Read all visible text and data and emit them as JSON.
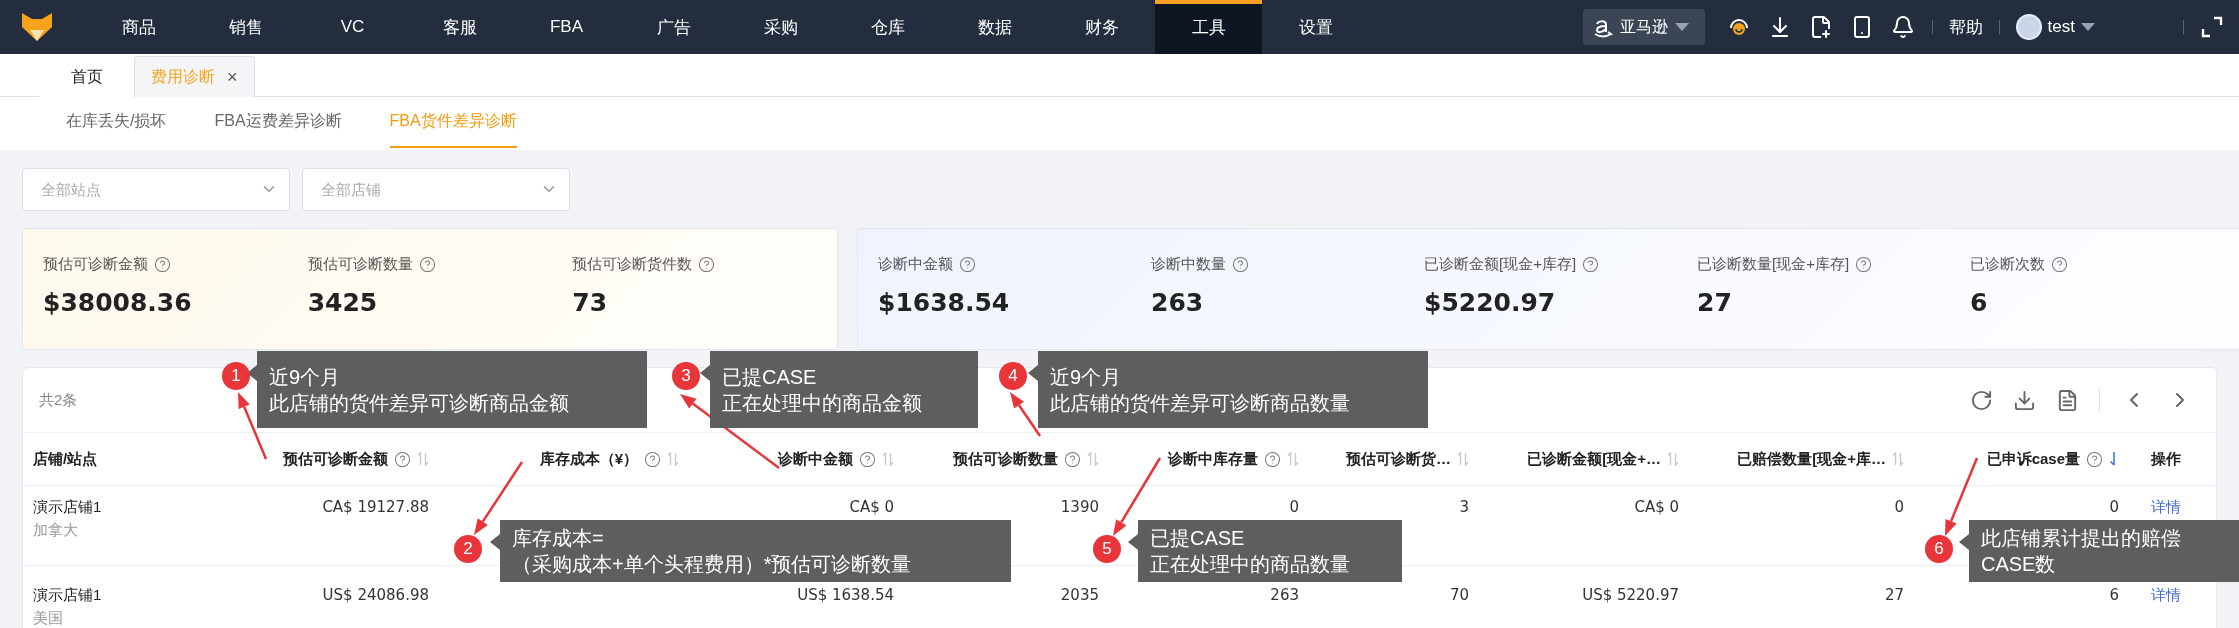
{
  "nav": {
    "items": [
      {
        "label": "商品",
        "selected": false
      },
      {
        "label": "销售",
        "selected": false
      },
      {
        "label": "VC",
        "selected": false
      },
      {
        "label": "客服",
        "selected": false
      },
      {
        "label": "FBA",
        "selected": false
      },
      {
        "label": "广告",
        "selected": false
      },
      {
        "label": "采购",
        "selected": false
      },
      {
        "label": "仓库",
        "selected": false
      },
      {
        "label": "数据",
        "selected": false
      },
      {
        "label": "财务",
        "selected": false
      },
      {
        "label": "工具",
        "selected": true
      },
      {
        "label": "设置",
        "selected": false
      }
    ],
    "platform": "亚马逊",
    "help": "帮助",
    "user": "test"
  },
  "page_tabs": [
    {
      "label": "首页",
      "selected": false
    },
    {
      "label": "费用诊断",
      "selected": true,
      "close": "×"
    }
  ],
  "sub_tabs": [
    {
      "label": "在库丢失/损坏",
      "selected": false
    },
    {
      "label": "FBA运费差异诊断",
      "selected": false
    },
    {
      "label": "FBA货件差异诊断",
      "selected": true
    }
  ],
  "filters": [
    {
      "placeholder": "全部站点"
    },
    {
      "placeholder": "全部店铺"
    }
  ],
  "summary_cards": [
    {
      "kind": "estimate",
      "metrics": [
        {
          "label": "预估可诊断金额",
          "value": "$38008.36"
        },
        {
          "label": "预估可诊断数量",
          "value": "3425"
        },
        {
          "label": "预估可诊断货件数",
          "value": "73"
        }
      ]
    },
    {
      "kind": "diagnosis",
      "metrics": [
        {
          "label": "诊断中金额",
          "value": "$1638.54"
        },
        {
          "label": "诊断中数量",
          "value": "263"
        },
        {
          "label": "已诊断金额[现金+库存]",
          "value": "$5220.97"
        },
        {
          "label": "已诊断数量[现金+库存]",
          "value": "27"
        },
        {
          "label": "已诊断次数",
          "value": "6"
        }
      ]
    }
  ],
  "table": {
    "count": "共2条",
    "columns": [
      {
        "label": "店铺/站点",
        "help": false,
        "sortable": false
      },
      {
        "label": "预估可诊断金额",
        "help": true,
        "sortable": true,
        "sorted": false
      },
      {
        "label": "库存成本（¥）",
        "help": true,
        "sortable": true,
        "sorted": false
      },
      {
        "label": "诊断中金额",
        "help": true,
        "sortable": true,
        "sorted": false
      },
      {
        "label": "预估可诊断数量",
        "help": true,
        "sortable": true,
        "sorted": false
      },
      {
        "label": "诊断中库存量",
        "help": true,
        "sortable": true,
        "sorted": false
      },
      {
        "label": "预估可诊断货…",
        "help": false,
        "sortable": true,
        "sorted": false
      },
      {
        "label": "已诊断金额[现金+…",
        "help": false,
        "sortable": true,
        "sorted": false
      },
      {
        "label": "已赔偿数量[现金+库…",
        "help": false,
        "sortable": true,
        "sorted": false
      },
      {
        "label": "已申诉case量",
        "help": true,
        "sortable": true,
        "sorted": true
      },
      {
        "label": "操作",
        "help": false,
        "sortable": false
      }
    ],
    "rows": [
      {
        "site": "加拿大",
        "cells": [
          "演示店铺1",
          "CA$ 19127.88",
          "",
          "CA$ 0",
          "1390",
          "0",
          "3",
          "CA$ 0",
          "0",
          "0",
          "详情"
        ]
      },
      {
        "site": "美国",
        "cells": [
          "演示店铺1",
          "US$ 24086.98",
          "",
          "US$ 1638.54",
          "2035",
          "263",
          "70",
          "US$ 5220.97",
          "27",
          "6",
          "详情"
        ]
      }
    ]
  },
  "annotations": [
    {
      "number": "1",
      "lines": [
        "近9个月",
        "此店铺的货件差异可诊断商品金额"
      ]
    },
    {
      "number": "3",
      "lines": [
        "已提CASE",
        "正在处理中的商品金额"
      ]
    },
    {
      "number": "4",
      "lines": [
        "近9个月",
        "此店铺的货件差异可诊断商品数量"
      ]
    },
    {
      "number": "2",
      "lines": [
        "库存成本=",
        "（采购成本+单个头程费用）*预估可诊断数量"
      ]
    },
    {
      "number": "5",
      "lines": [
        "已提CASE",
        "正在处理中的商品数量"
      ]
    },
    {
      "number": "6",
      "lines": [
        "此店铺累计提出的赔偿",
        "CASE数"
      ]
    }
  ]
}
